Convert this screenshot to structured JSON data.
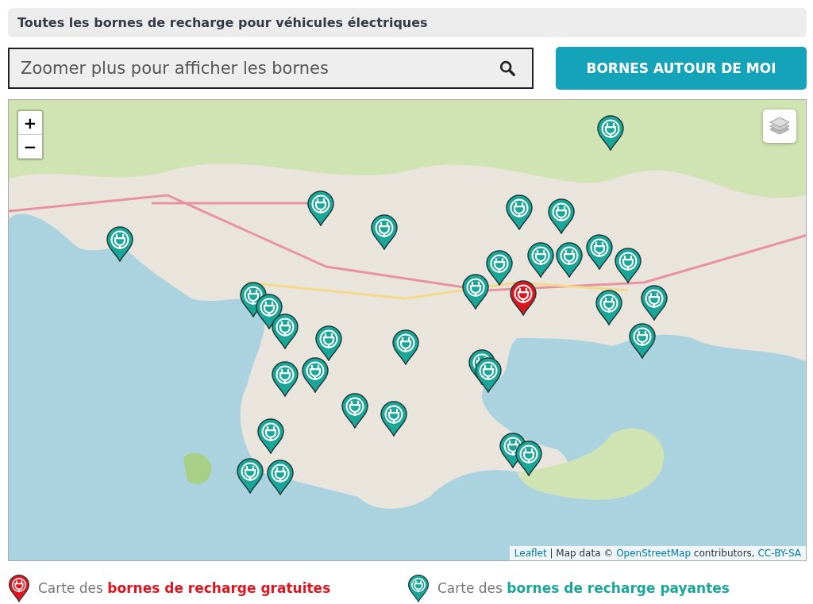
{
  "header": {
    "title": "Toutes les bornes de recharge pour véhicules électriques"
  },
  "search": {
    "placeholder": "Zoomer plus pour afficher les bornes"
  },
  "nearby_button": {
    "label": "BORNES AUTOUR DE MOI"
  },
  "map": {
    "zoom_in": "+",
    "zoom_out": "−",
    "markers": [
      {
        "kind": "paid"
      },
      {
        "kind": "paid"
      },
      {
        "kind": "paid"
      },
      {
        "kind": "paid"
      },
      {
        "kind": "paid"
      },
      {
        "kind": "paid"
      },
      {
        "kind": "paid"
      },
      {
        "kind": "paid"
      },
      {
        "kind": "paid"
      },
      {
        "kind": "paid"
      },
      {
        "kind": "paid"
      },
      {
        "kind": "paid"
      },
      {
        "kind": "paid"
      },
      {
        "kind": "paid"
      },
      {
        "kind": "paid"
      },
      {
        "kind": "paid"
      },
      {
        "kind": "paid"
      },
      {
        "kind": "paid"
      },
      {
        "kind": "paid"
      },
      {
        "kind": "paid"
      },
      {
        "kind": "paid"
      },
      {
        "kind": "paid"
      },
      {
        "kind": "paid"
      },
      {
        "kind": "paid"
      },
      {
        "kind": "paid"
      },
      {
        "kind": "paid"
      },
      {
        "kind": "paid"
      },
      {
        "kind": "paid"
      },
      {
        "kind": "paid"
      },
      {
        "kind": "paid"
      },
      {
        "kind": "paid"
      },
      {
        "kind": "free"
      }
    ],
    "attribution": {
      "leaflet": "Leaflet",
      "separator": "| Map data ©",
      "osm": "OpenStreetMap",
      "contributors": "contributors,",
      "license": "CC-BY-SA"
    }
  },
  "legend": [
    {
      "kind": "free",
      "prefix": "Carte des",
      "emphasis": "bornes de recharge gratuites"
    },
    {
      "kind": "paid",
      "prefix": "Carte des",
      "emphasis": "bornes de recharge payantes"
    }
  ]
}
